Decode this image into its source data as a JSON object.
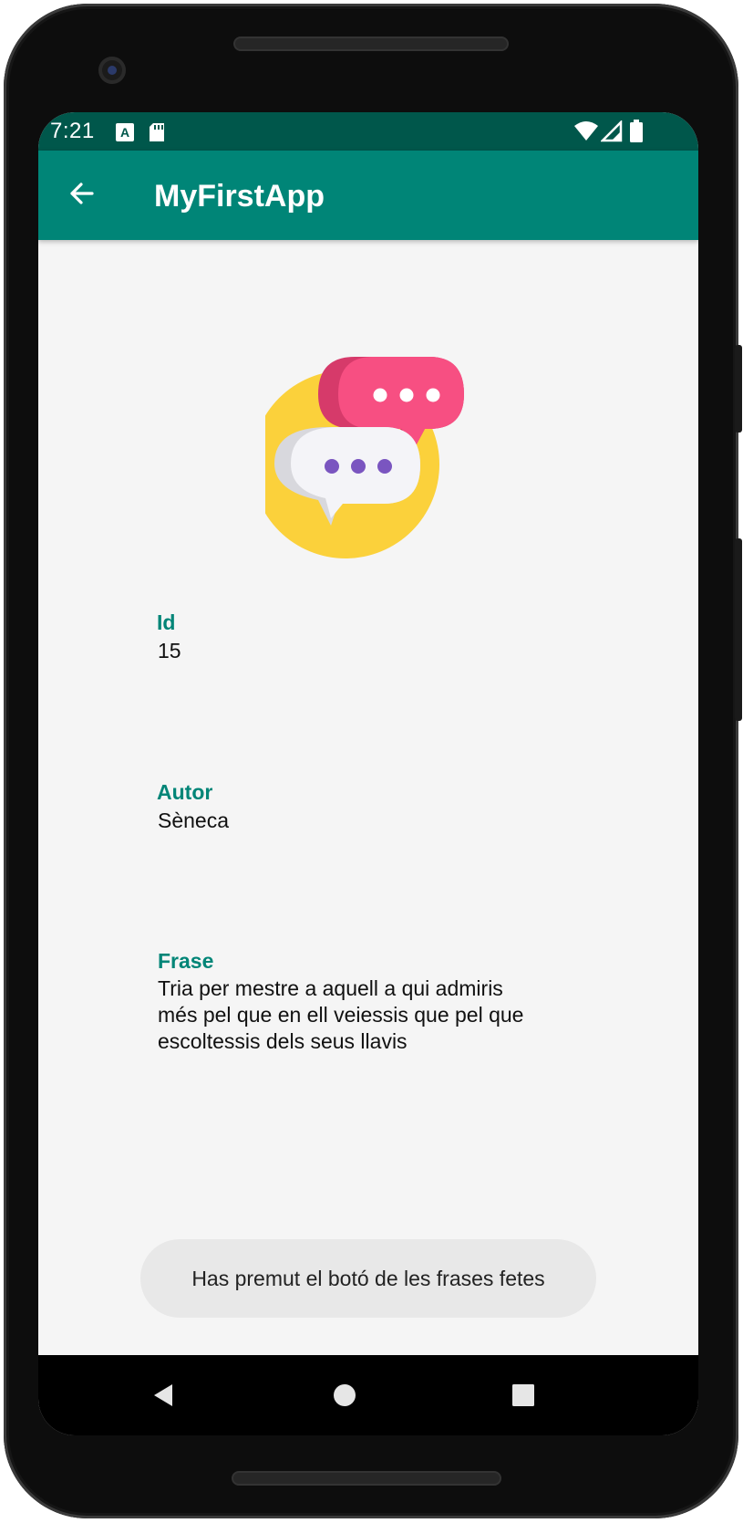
{
  "status_bar": {
    "time": "7:21",
    "background": "#00574b",
    "icons_left": [
      "a-notification-icon",
      "sd-card-icon"
    ],
    "icons_right": [
      "wifi-icon",
      "signal-icon",
      "battery-icon"
    ]
  },
  "app_bar": {
    "title": "MyFirstApp",
    "background": "#008577",
    "back_icon": "arrow-back-icon"
  },
  "logo": {
    "icon": "chat-bubbles-icon",
    "colors": {
      "circle": "#fbd13b",
      "pink_bubble": "#f74f82",
      "white_bubble": "#f4f4f8",
      "dots_purple": "#7a55c0"
    }
  },
  "fields": {
    "id": {
      "label": "Id",
      "value": "15"
    },
    "autor": {
      "label": "Autor",
      "value": "Sèneca"
    },
    "frase": {
      "label": "Frase",
      "lines": [
        "Tria per mestre a aquell a qui admiris",
        "més pel que en ell veiessis que pel que",
        "escoltessis dels seus llavis"
      ]
    }
  },
  "toast": {
    "message": "Has premut el botó de les frases fetes"
  },
  "navigation": {
    "buttons": [
      "back-triangle-icon",
      "home-circle-icon",
      "recents-square-icon"
    ]
  },
  "colors": {
    "accent": "#008577",
    "label": "#008577",
    "screen_bg": "#f5f5f5",
    "toast_bg": "#e8e8e8"
  }
}
